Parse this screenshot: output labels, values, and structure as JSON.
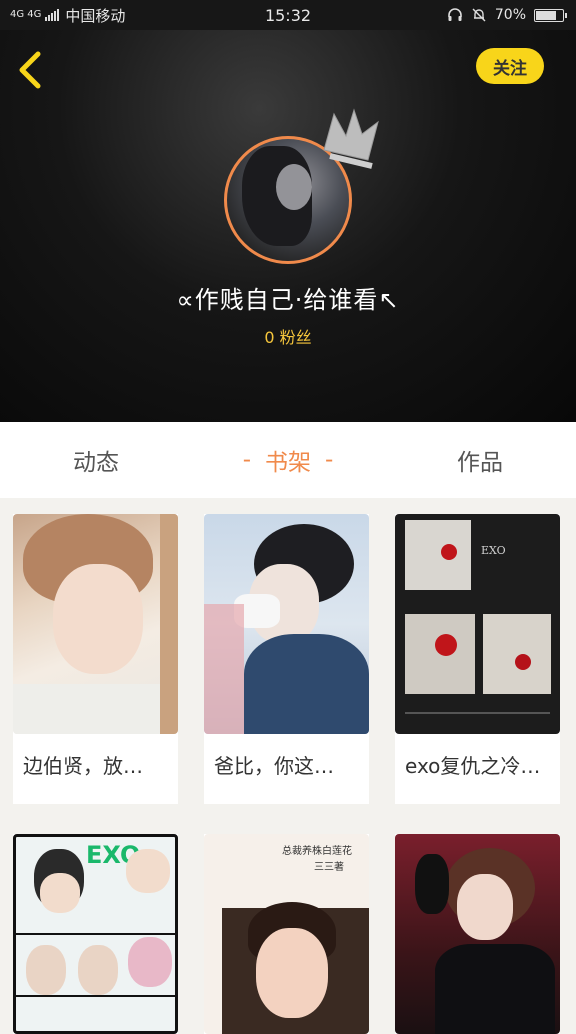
{
  "status_bar": {
    "network": "4G 4G",
    "carrier": "中国移动",
    "time": "15:32",
    "battery": "70%",
    "headphone_icon": "headphone-icon",
    "mute_icon": "bell-off-icon"
  },
  "header": {
    "back_icon": "chevron-left-icon",
    "follow_label": "关注",
    "username": "∝作贱自己·给谁看↖",
    "fans": "0 粉丝"
  },
  "tabs": [
    {
      "label": "动态",
      "active": false
    },
    {
      "label": "书架",
      "active": true
    },
    {
      "label": "作品",
      "active": false
    }
  ],
  "active_tab_decoration": "-",
  "books": [
    {
      "title": "边伯贤，放…"
    },
    {
      "title": "爸比，你这…"
    },
    {
      "title": "exo复仇之冷…"
    },
    {
      "cover_text": "EXO"
    },
    {
      "cover_text": "总裁养株白莲花",
      "cover_subtext": "三三著"
    },
    {}
  ],
  "colors": {
    "accent": "#f08a4b",
    "follow_button": "#f8d51a",
    "fans_text": "#f6c63c",
    "back_arrow": "#f8d51a"
  }
}
